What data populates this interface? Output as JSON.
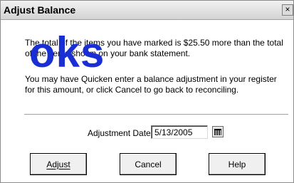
{
  "dialog": {
    "title": "Adjust Balance",
    "close_glyph": "×",
    "message_1": "The total of the items you have marked is $25.50 more than the total of the items shown on your bank statement.",
    "message_2": "You may have Quicken enter a balance adjustment in your register for this amount, or click Cancel to go back to reconciling.",
    "date_label": "Adjustment Date:",
    "date_value": "5/13/2005",
    "buttons": {
      "adjust": "Adjust",
      "cancel": "Cancel",
      "help": "Help"
    }
  },
  "watermark_text": "oks",
  "icons": {
    "close": "close-icon",
    "calendar": "calendar-icon"
  },
  "colors": {
    "watermark": "#1a2fd3",
    "titlebar": "#d3d3d3"
  }
}
